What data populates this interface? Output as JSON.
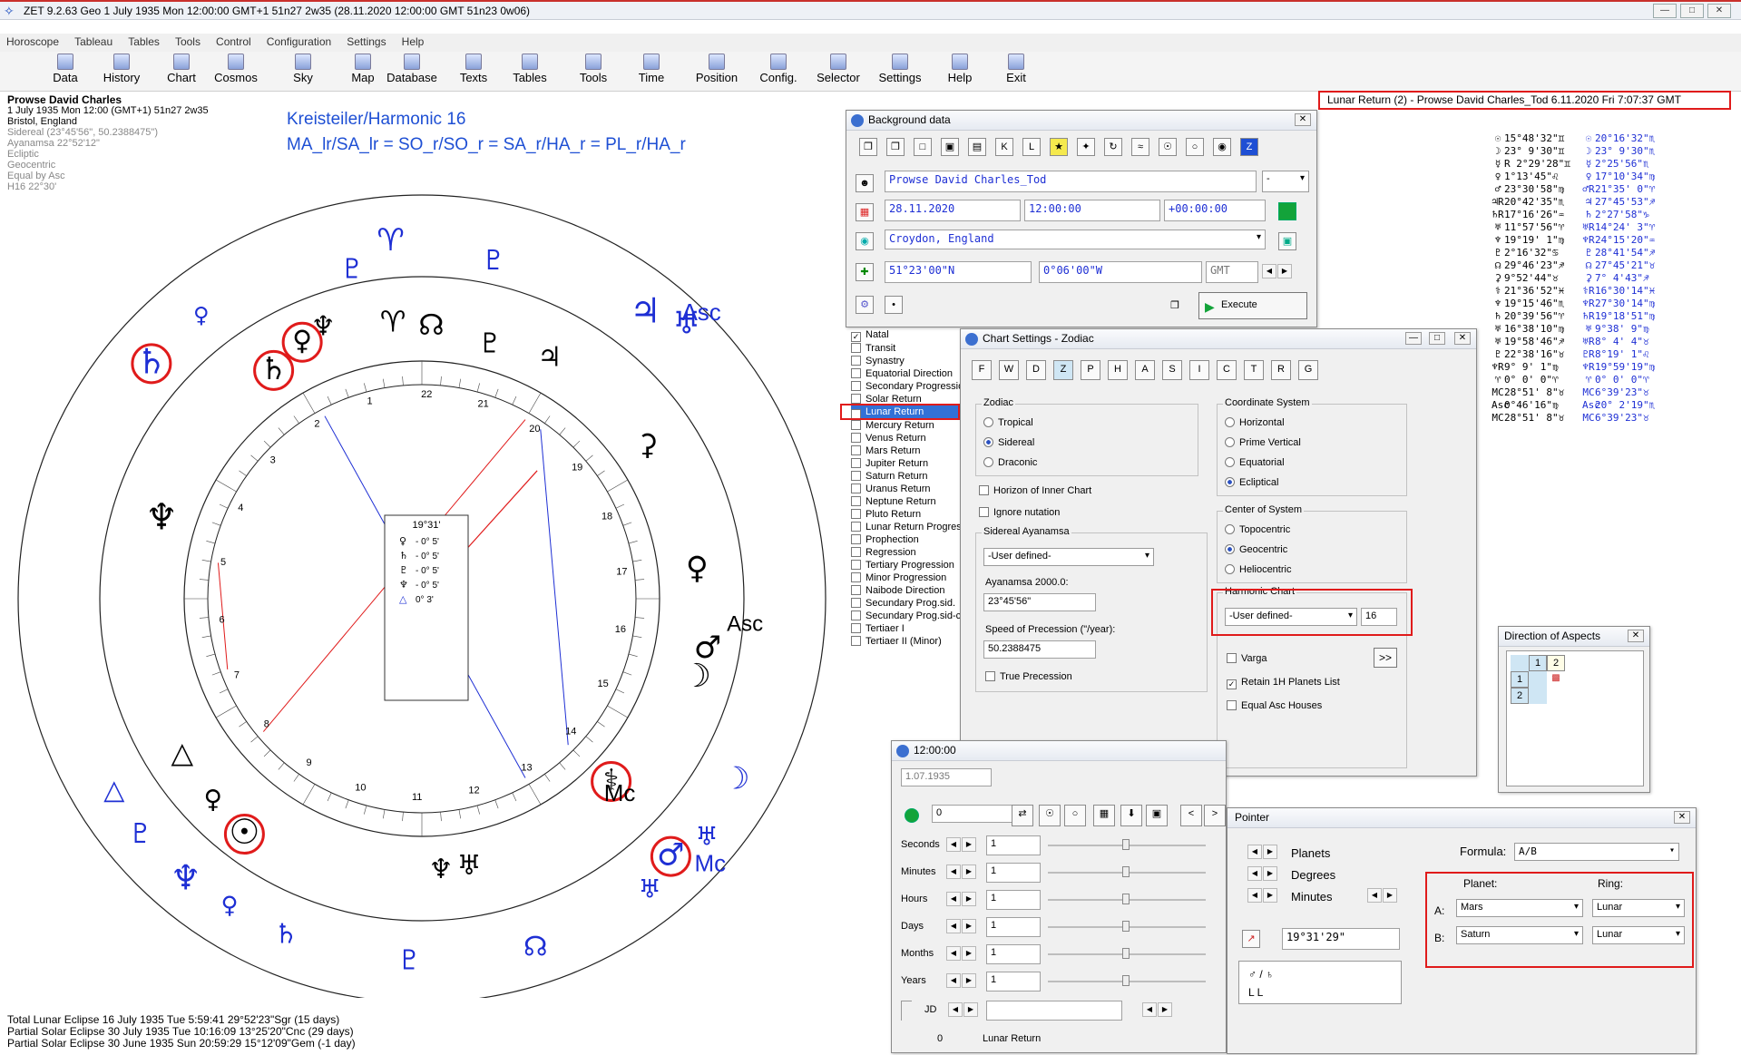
{
  "window": {
    "title": "ZET 9.2.63 Geo    1 July 1935   Mon   12:00:00 GMT+1  51n27   2w35    (28.11.2020   12:00:00 GMT  51n23  0w06)",
    "minimize": "—",
    "maximize": "□",
    "close": "✕"
  },
  "menu": [
    "Horoscope",
    "Tableau",
    "Tables",
    "Tools",
    "Control",
    "Configuration",
    "Settings",
    "Help"
  ],
  "toolbar": [
    {
      "label": "Data",
      "icon": "data-icon"
    },
    {
      "label": "History",
      "icon": "history-icon"
    },
    {
      "label": "Chart",
      "icon": "chart-icon"
    },
    {
      "label": "Cosmos",
      "icon": "cosmos-icon"
    },
    {
      "label": "Sky",
      "icon": "sky-icon"
    },
    {
      "label": "Map",
      "icon": "map-icon"
    },
    {
      "label": "Database",
      "icon": "database-icon"
    },
    {
      "label": "Texts",
      "icon": "texts-icon"
    },
    {
      "label": "Tables",
      "icon": "tables-icon"
    },
    {
      "label": "Tools",
      "icon": "tools-icon"
    },
    {
      "label": "Time",
      "icon": "time-icon"
    },
    {
      "label": "Position",
      "icon": "position-icon"
    },
    {
      "label": "Config.",
      "icon": "config-icon"
    },
    {
      "label": "Selector",
      "icon": "selector-icon"
    },
    {
      "label": "Settings",
      "icon": "settings-icon"
    },
    {
      "label": "Help",
      "icon": "help-icon"
    },
    {
      "label": "Exit",
      "icon": "exit-icon"
    }
  ],
  "info": {
    "name": "Prowse David Charles",
    "date_line": "1 July 1935   Mon   12:00 (GMT+1)  51n27   2w35",
    "place": "Bristol, England",
    "details": [
      "Sidereal (23°45'56\", 50.2388475\")",
      "Ayanamsa 22°52'12\"",
      "Ecliptic",
      "Geocentric",
      "Equal by Asc",
      "H16  22°30'"
    ]
  },
  "harmonic_title": "Kreisteiler/Harmonic 16",
  "harmonic_formula": "MA_lr/SA_lr = SO_r/SO_r = SA_r/HA_r = PL_r/HA_r",
  "chart": {
    "center_box": {
      "header": "19°31'",
      "rows": [
        {
          "g": "♀",
          "v": "- 0° 5'"
        },
        {
          "g": "♄",
          "v": "- 0° 5'"
        },
        {
          "g": "♇",
          "v": "- 0° 5'"
        },
        {
          "g": "♆",
          "v": "- 0° 5'"
        },
        {
          "g": "△",
          "v": "0° 3'"
        }
      ]
    },
    "house_numbers": [
      "1",
      "2",
      "3",
      "4",
      "5",
      "6",
      "7",
      "8",
      "9",
      "10",
      "11",
      "12",
      "13",
      "14",
      "15",
      "16",
      "17",
      "18",
      "19",
      "20",
      "21",
      "22"
    ],
    "labels": {
      "asc": "Asc",
      "mc": "Mc"
    },
    "colors": {
      "inner": "#000000",
      "outer": "#1e2fd4",
      "highlight": "#e01b1b"
    }
  },
  "eclipses": [
    "Total Lunar Eclipse 16 July 1935 Tue   5:59:41 29°52'23\"Sgr (15 days)",
    "Partial Solar Eclipse 30 July 1935 Tue 10:16:09 13°25'20\"Cnc (29 days)",
    "Partial Solar Eclipse 30 June 1935 Sun 20:59:29 15°12'09\"Gem (-1 day)"
  ],
  "lunar_return_header": "Lunar Return (2) - Prowse David Charles_Tod   6.11.2020   Fri   7:07:37 GMT",
  "positions": [
    {
      "s1": "☉",
      "v1": "15°48'32\"♊",
      "s2": "☉",
      "v2": "20°16'32\"♏"
    },
    {
      "s1": "☽",
      "v1": "23° 9'30\"♊",
      "s2": "☽",
      "v2": "23° 9'30\"♏"
    },
    {
      "s1": "☿",
      "v1": "R 2°29'28\"♊",
      "s2": "☿",
      "v2": "2°25'56\"♏"
    },
    {
      "s1": "♀",
      "v1": "1°13'45\"♌",
      "s2": "♀",
      "v2": "17°10'34\"♍"
    },
    {
      "s1": "♂",
      "v1": "23°30'58\"♍",
      "s2": "♂R",
      "v2": "21°35' 0\"♈"
    },
    {
      "s1": "♃R",
      "v1": "20°42'35\"♏",
      "s2": "♃",
      "v2": "27°45'53\"♐"
    },
    {
      "s1": "♄R",
      "v1": "17°16'26\"♒",
      "s2": "♄",
      "v2": "2°27'58\"♑"
    },
    {
      "s1": "♅",
      "v1": "11°57'56\"♈",
      "s2": "♅R",
      "v2": "14°24' 3\"♈"
    },
    {
      "s1": "♆",
      "v1": "19°19' 1\"♍",
      "s2": "♆R",
      "v2": "24°15'20\"♒"
    },
    {
      "s1": "♇",
      "v1": "2°16'32\"♋",
      "s2": "♇",
      "v2": "28°41'54\"♐"
    },
    {
      "s1": "☊",
      "v1": "29°46'23\"♐",
      "s2": "☊",
      "v2": "27°45'21\"♉"
    },
    {
      "s1": "⚳",
      "v1": "9°52'44\"♉",
      "s2": "⚳",
      "v2": "7° 4'43\"♐"
    },
    {
      "s1": "⚕",
      "v1": "21°36'52\"♓",
      "s2": "⚕R",
      "v2": "16°30'14\"♓"
    },
    {
      "s1": "♆",
      "v1": "19°15'46\"♏",
      "s2": "♆R",
      "v2": "27°30'14\"♍"
    },
    {
      "s1": "♄",
      "v1": "20°39'56\"♈",
      "s2": "♄R",
      "v2": "19°18'51\"♍"
    },
    {
      "s1": "♅",
      "v1": "16°38'10\"♍",
      "s2": "♅",
      "v2": "9°38' 9\"♍"
    },
    {
      "s1": "♅",
      "v1": "19°58'46\"♐",
      "s2": "♅R",
      "v2": "8° 4' 4\"♉"
    },
    {
      "s1": "♇",
      "v1": "22°38'16\"♉",
      "s2": "♇R",
      "v2": "8°19' 1\"♌"
    },
    {
      "s1": "♆R",
      "v1": "9° 9' 1\"♍",
      "s2": "♆R",
      "v2": "19°59'19\"♍"
    },
    {
      "s1": "♈",
      "v1": "0° 0' 0\"♈",
      "s2": "♈",
      "v2": "0° 0' 0\"♈"
    },
    {
      "s1": "MC",
      "v1": "28°51' 8\"♉",
      "s2": "MC",
      "v2": "6°39'23\"♉"
    },
    {
      "s1": "Asc",
      "v1": "0°46'16\"♍",
      "s2": "Asc",
      "v2": "20° 2'19\"♏"
    },
    {
      "s1": "MC",
      "v1": "28°51' 8\"♉",
      "s2": "MC",
      "v2": "6°39'23\"♉"
    }
  ],
  "background_data": {
    "title": "Background data",
    "close": "✕",
    "name": "Prowse David Charles_Tod",
    "name_dropdown": "-",
    "date": "28.11.2020",
    "time": "12:00:00",
    "offset": "+00:00:00",
    "place": "Croydon, England",
    "lat": "51°23'00\"N",
    "lon": "0°06'00\"W",
    "tz": "GMT",
    "execute": "Execute"
  },
  "chart_types": [
    "Natal",
    "Transit",
    "Synastry",
    "Equatorial Direction",
    "Secondary Progressio",
    "Solar Return",
    "Lunar Return",
    "Mercury Return",
    "Venus Return",
    "Mars Return",
    "Jupiter Return",
    "Saturn Return",
    "Uranus Return",
    "Neptune Return",
    "Pluto Return",
    "Lunar Return Progress",
    "Prophection",
    "Regression",
    "Tertiary Progression",
    "Minor Progression",
    "Naibode Direction",
    "Secundary Prog.sid.",
    "Secundary Prog.sid-c",
    "Tertiaer I",
    "Tertiaer II (Minor)"
  ],
  "chart_settings": {
    "title": "Chart Settings - Zodiac",
    "close": "✕",
    "zodiac_label": "Zodiac",
    "zodiac_options": [
      "Tropical",
      "Sidereal",
      "Draconic"
    ],
    "horizon_inner": "Horizon of Inner Chart",
    "ignore_nutation": "Ignore nutation",
    "ayanamsa_label": "Sidereal Ayanamsa",
    "ayanamsa_select": "-User defined-",
    "ayanamsa2000_label": "Ayanamsa 2000.0:",
    "ayanamsa2000_value": "23°45'56\"",
    "precession_label": "Speed of Precession (\"/year):",
    "precession_value": "50.2388475",
    "true_precession": "True Precession",
    "coord_label": "Coordinate System",
    "coord_options": [
      "Horizontal",
      "Prime Vertical",
      "Equatorial",
      "Ecliptical"
    ],
    "center_label": "Center of System",
    "center_options": [
      "Topocentric",
      "Geocentric",
      "Heliocentric"
    ],
    "harmonic_label": "Harmonic Chart",
    "harmonic_select": "-User defined-",
    "harmonic_value": "16",
    "varga": "Varga",
    "varga_button": ">>",
    "retain_1h": "Retain 1H Planets List",
    "equal_asc": "Equal Asc Houses"
  },
  "direction_aspects": {
    "title": "Direction of Aspects",
    "close": "✕",
    "cols": [
      "1",
      "2"
    ],
    "rows": [
      "1",
      "2"
    ]
  },
  "time_panel": {
    "title": "12:00:00",
    "date": "1.07.1935",
    "value": "0",
    "rows": [
      {
        "label": "Seconds",
        "value": "1"
      },
      {
        "label": "Minutes",
        "value": "1"
      },
      {
        "label": "Hours",
        "value": "1"
      },
      {
        "label": "Days",
        "value": "1"
      },
      {
        "label": "Months",
        "value": "1"
      },
      {
        "label": "Years",
        "value": "1"
      }
    ],
    "jd_label": "JD",
    "status_num": "0",
    "status_text": "Lunar Return"
  },
  "pointer": {
    "title": "Pointer",
    "close": "✕",
    "planets": "Planets",
    "degrees": "Degrees",
    "minutes": "Minutes",
    "formula_label": "Formula:",
    "formula_value": "A/B",
    "planet_label": "Planet:",
    "ring_label": "Ring:",
    "a_label": "A:",
    "b_label": "B:",
    "a_planet": "Mars",
    "a_ring": "Lunar",
    "b_planet": "Saturn",
    "b_ring": "Lunar",
    "result": "19°31'29\"",
    "result_glyphs": "♂ / ♄",
    "result_rings": "L   L"
  }
}
